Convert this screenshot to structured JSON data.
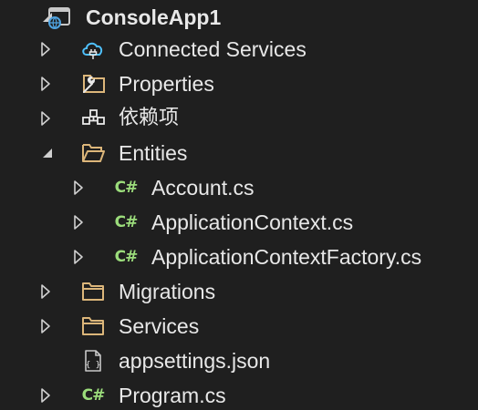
{
  "project": {
    "name": "ConsoleApp1",
    "icon": "csharp-project-icon"
  },
  "tree": {
    "connected_services": {
      "label": "Connected Services",
      "icon": "connected-services-icon"
    },
    "properties": {
      "label": "Properties",
      "icon": "properties-folder-icon"
    },
    "dependencies": {
      "label": "依赖项",
      "icon": "dependencies-icon"
    },
    "entities": {
      "label": "Entities",
      "icon": "folder-open-icon",
      "children": [
        {
          "label": "Account.cs",
          "icon": "csharp-file-icon"
        },
        {
          "label": "ApplicationContext.cs",
          "icon": "csharp-file-icon"
        },
        {
          "label": "ApplicationContextFactory.cs",
          "icon": "csharp-file-icon"
        }
      ]
    },
    "migrations": {
      "label": "Migrations",
      "icon": "folder-icon"
    },
    "services": {
      "label": "Services",
      "icon": "folder-icon"
    },
    "appsettings": {
      "label": "appsettings.json",
      "icon": "json-file-icon"
    },
    "program": {
      "label": "Program.cs",
      "icon": "csharp-file-icon"
    }
  },
  "csharp_glyph": "C#",
  "json_glyph": "{ }",
  "colors": {
    "background": "#1f1f1f",
    "text": "#e8e8e8",
    "folder": "#dcb67a",
    "csharp": "#9bdc7b",
    "accent": "#4fc1ff"
  }
}
